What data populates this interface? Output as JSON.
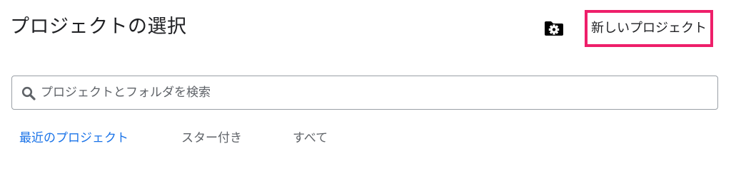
{
  "header": {
    "title": "プロジェクトの選択",
    "folder_settings_icon": "folder-gear-icon",
    "new_project_label": "新しいプロジェクト",
    "highlight_color": "#ee1f6a"
  },
  "search": {
    "icon": "search-icon",
    "placeholder": "プロジェクトとフォルダを検索",
    "value": ""
  },
  "tabs": [
    {
      "label": "最近のプロジェクト",
      "active": true
    },
    {
      "label": "スター付き",
      "active": false
    },
    {
      "label": "すべて",
      "active": false
    }
  ],
  "colors": {
    "accent": "#1a73e8",
    "text": "#202124",
    "muted": "#5f6368"
  }
}
